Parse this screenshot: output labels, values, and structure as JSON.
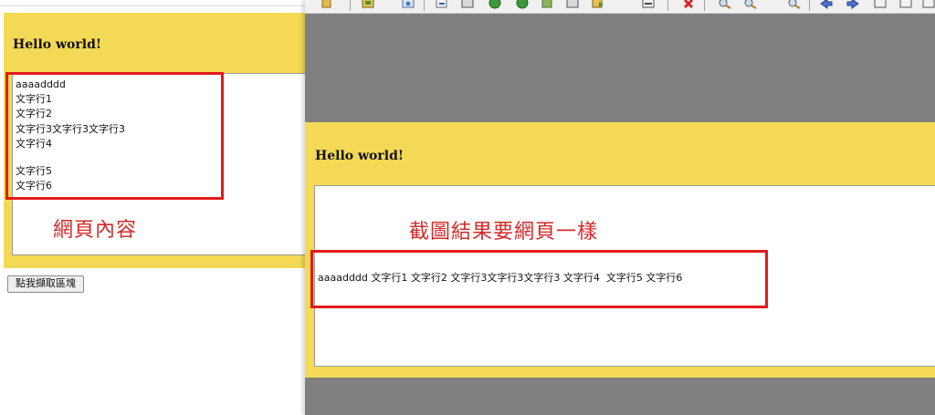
{
  "left_page": {
    "heading": "Hello world!",
    "lines": [
      "aaaadddd",
      "文字行1",
      "文字行2",
      "文字行3文字行3文字行3",
      "文字行4",
      "文字行5",
      "文字行6"
    ],
    "annotation": "網頁內容",
    "capture_button": "點我擷取區塊"
  },
  "viewer": {
    "toolbar_icons": [
      "open-icon",
      "save-icon",
      "help-icon",
      "export-icon",
      "print-icon",
      "globe-icon",
      "globe-icon",
      "copy-icon",
      "page-icon",
      "send-icon",
      "insert-icon",
      "delete-icon",
      "zoom-in-icon",
      "zoom-fit-icon",
      "zoom-out-icon",
      "arrow-left-icon",
      "arrow-right-icon",
      "window-icon",
      "window-icon",
      "window-icon"
    ],
    "heading": "Hello world!",
    "annotation": "截圖結果要網頁一樣",
    "rendered_line": "aaaadddd 文字行1 文字行2 文字行3文字行3文字行3 文字行4  文字行5 文字行6"
  },
  "colors": {
    "panel_yellow": "#f3d955",
    "annotation_red": "#e21a1a",
    "viewer_gray": "#7f7f7f"
  }
}
